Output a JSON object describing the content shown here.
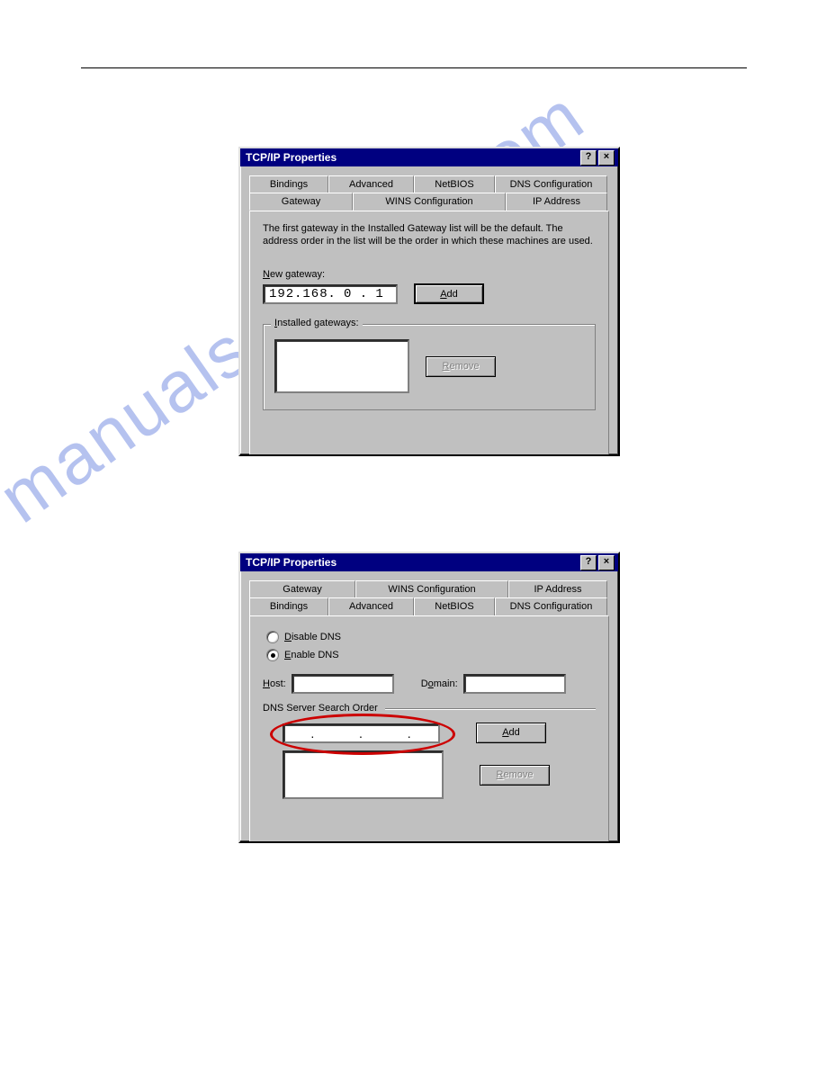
{
  "watermark_text": "manualsarchive.com",
  "dialog1": {
    "title": "TCP/IP Properties",
    "tabs_back": [
      "Bindings",
      "Advanced",
      "NetBIOS",
      "DNS Configuration"
    ],
    "tabs_front": [
      "Gateway",
      "WINS Configuration",
      "IP Address"
    ],
    "active_tab": "Gateway",
    "description": "The first gateway in the Installed Gateway list will be the default. The address order in the list will be the order in which these machines are used.",
    "new_gateway_label": "New gateway:",
    "new_gateway_underline": "N",
    "ip": {
      "o1": "192",
      "o2": "168",
      "o3": "0",
      "o4": "1"
    },
    "add_label": "Add",
    "add_underline": "A",
    "installed_label": "Installed gateways:",
    "installed_underline": "I",
    "remove_label": "Remove",
    "remove_underline": "R"
  },
  "dialog2": {
    "title": "TCP/IP Properties",
    "tabs_back": [
      "Gateway",
      "WINS Configuration",
      "IP Address"
    ],
    "tabs_front": [
      "Bindings",
      "Advanced",
      "NetBIOS",
      "DNS Configuration"
    ],
    "active_tab": "DNS Configuration",
    "disable_label": "Disable DNS",
    "disable_underline": "D",
    "enable_label": "Enable DNS",
    "enable_underline": "E",
    "selected_radio": "enable",
    "host_label": "Host:",
    "host_underline": "H",
    "domain_label": "Domain:",
    "domain_underline": "o",
    "dns_order_label": "DNS Server Search Order",
    "add_label": "Add",
    "add_underline": "A",
    "remove_label": "Remove",
    "remove_underline": "R"
  }
}
